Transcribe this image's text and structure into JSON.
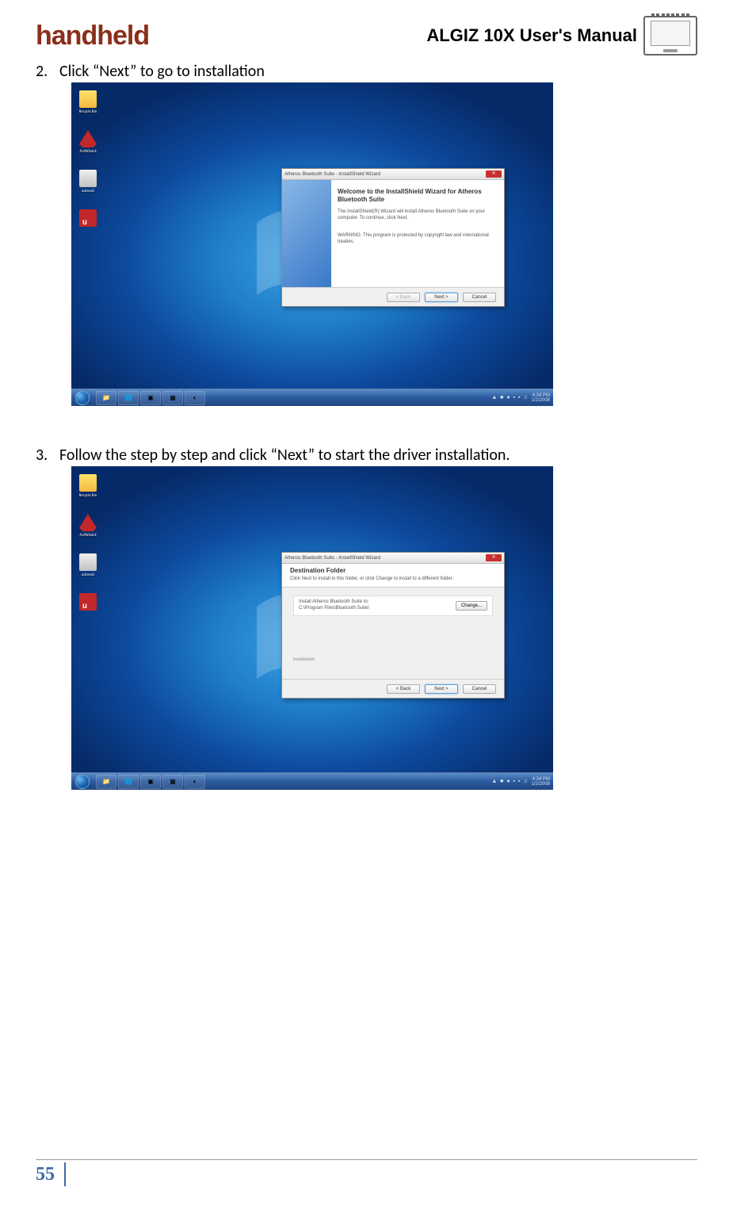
{
  "header": {
    "logo_text": "handheld",
    "manual_title": "ALGIZ 10X User's Manual"
  },
  "steps": [
    {
      "num": "2.",
      "text": "Click “Next” to go to installation"
    },
    {
      "num": "3.",
      "text": "Follow the step by step and click “Next” to start the driver installation."
    }
  ],
  "screenshot1": {
    "desktop_icons": [
      {
        "label": "Recycle Bin"
      },
      {
        "label": "AvtWizard"
      },
      {
        "label": "autowiz"
      },
      {
        "label": ""
      }
    ],
    "taskbar": {
      "systray_icons": "▲ ■ ● ▪ ▪ ♫",
      "time": "4:34 PM",
      "date": "1/2/2008"
    },
    "wizard": {
      "title": "Atheros Bluetooth Suite - InstallShield Wizard",
      "heading": "Welcome to the InstallShield Wizard for Atheros Bluetooth Suite",
      "body1": "The InstallShield(R) Wizard will install Atheros Bluetooth Suite on your computer. To continue, click Next.",
      "body2": "WARNING: This program is protected by copyright law and international treaties.",
      "buttons": {
        "back": "< Back",
        "next": "Next >",
        "cancel": "Cancel"
      }
    }
  },
  "screenshot2": {
    "desktop_icons": [
      {
        "label": "Recycle Bin"
      },
      {
        "label": "AvtWizard"
      },
      {
        "label": "autowiz"
      },
      {
        "label": ""
      }
    ],
    "taskbar": {
      "systray_icons": "▲ ■ ● ▪ ▪ ♫",
      "time": "4:34 PM",
      "date": "1/2/2008"
    },
    "wizard": {
      "title": "Atheros Bluetooth Suite - InstallShield Wizard",
      "heading": "Destination Folder",
      "subheading": "Click Next to install to this folder, or click Change to install to a different folder.",
      "dest_label": "Install Atheros Bluetooth Suite to:",
      "dest_path": "C:\\Program Files\\Bluetooth Suite\\",
      "change_btn": "Change...",
      "installshield_label": "InstallShield",
      "buttons": {
        "back": "< Back",
        "next": "Next >",
        "cancel": "Cancel"
      }
    }
  },
  "footer": {
    "page_num": "55"
  }
}
